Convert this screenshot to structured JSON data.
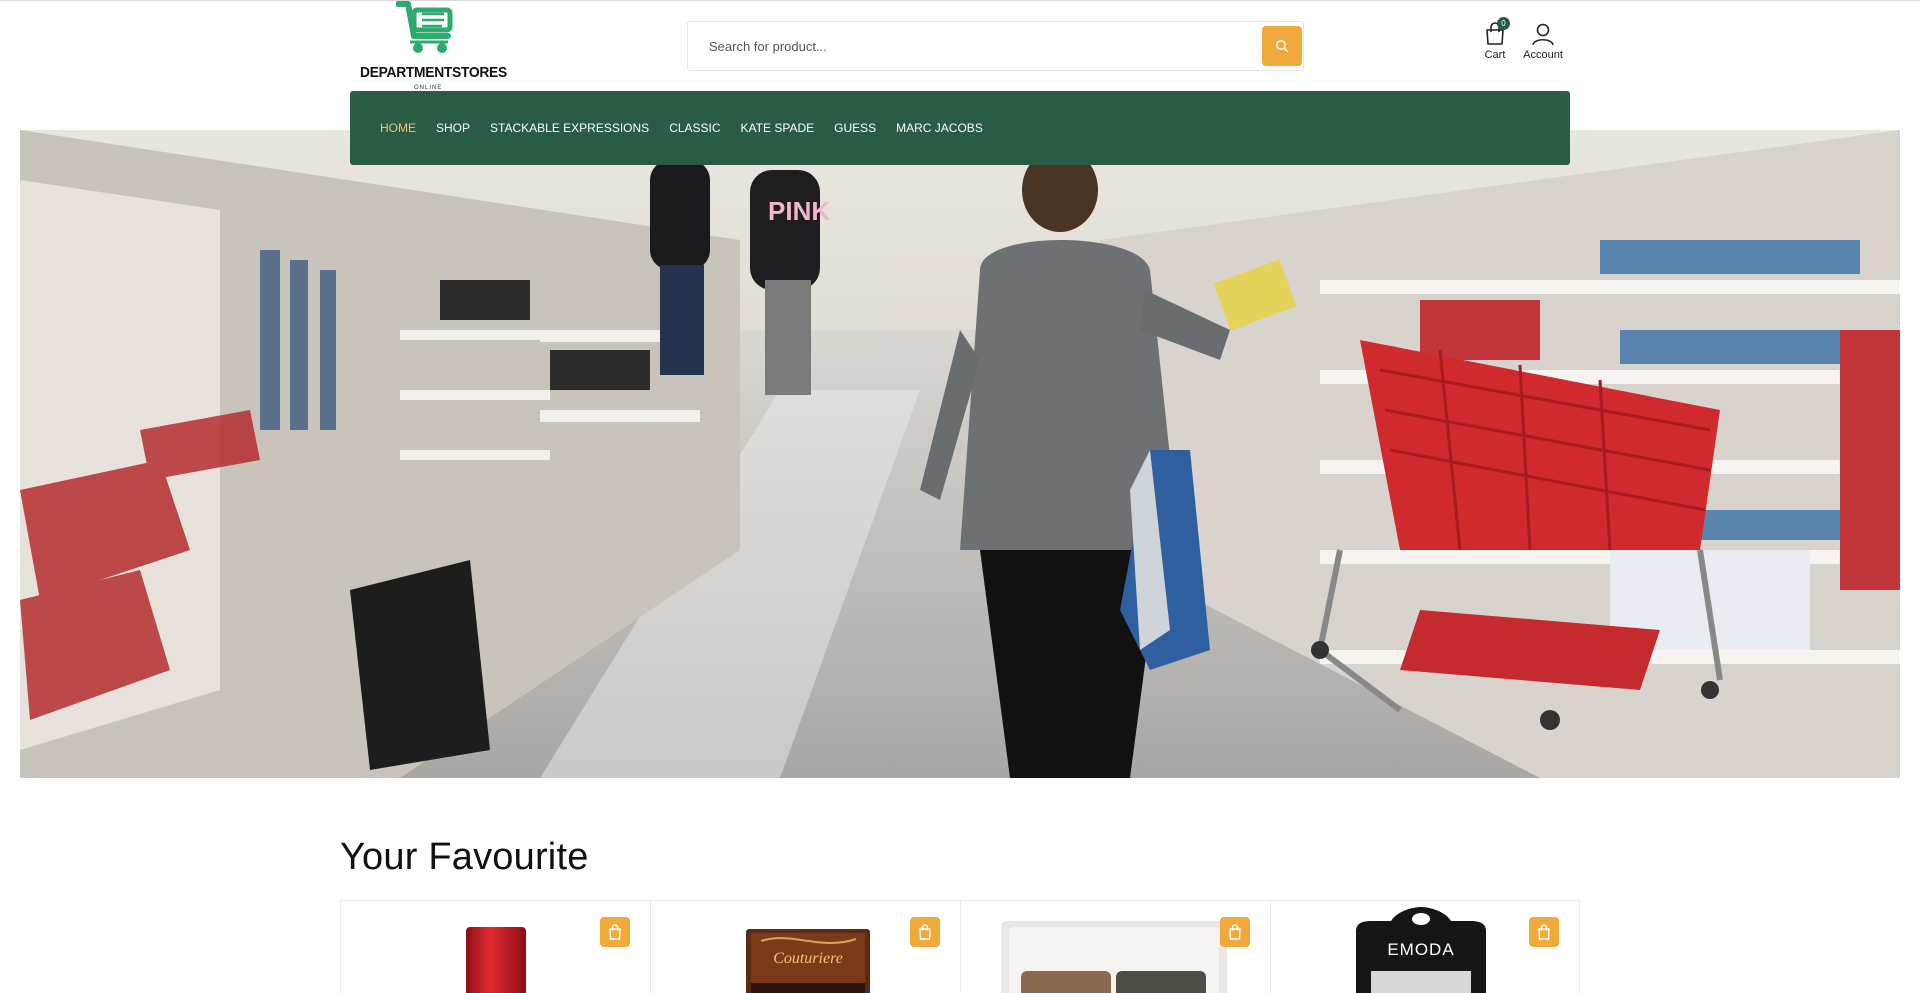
{
  "brand": {
    "name": "DEPARTMENTSTORES",
    "tagline": "ONLINE",
    "color": "#2eaa6e"
  },
  "search": {
    "placeholder": "Search for product...",
    "button_icon": "search-icon"
  },
  "header": {
    "cart_label": "Cart",
    "cart_count": "0",
    "account_label": "Account"
  },
  "nav": {
    "items": [
      {
        "label": "HOME",
        "active": true
      },
      {
        "label": "SHOP"
      },
      {
        "label": "STACKABLE EXPRESSIONS"
      },
      {
        "label": "CLASSIC"
      },
      {
        "label": "KATE SPADE"
      },
      {
        "label": "GUESS"
      },
      {
        "label": "MARC JACOBS"
      }
    ]
  },
  "hero": {
    "image": "store-aisle-photo"
  },
  "favourites": {
    "title": "Your Favourite",
    "products": [
      {
        "image": "red-lipstick",
        "cart_icon": "shopping-bag-icon"
      },
      {
        "image": "couturiere-eyelash-box",
        "cart_icon": "shopping-bag-icon",
        "image_text": "Couturiere"
      },
      {
        "image": "eyeshadow-palette",
        "cart_icon": "shopping-bag-icon"
      },
      {
        "image": "emoda-product-pack",
        "cart_icon": "shopping-bag-icon",
        "image_text": "EMODA"
      }
    ]
  },
  "colors": {
    "nav_bg": "#2a5b45",
    "accent": "#f0a93b",
    "nav_active": "#f5c76a"
  }
}
